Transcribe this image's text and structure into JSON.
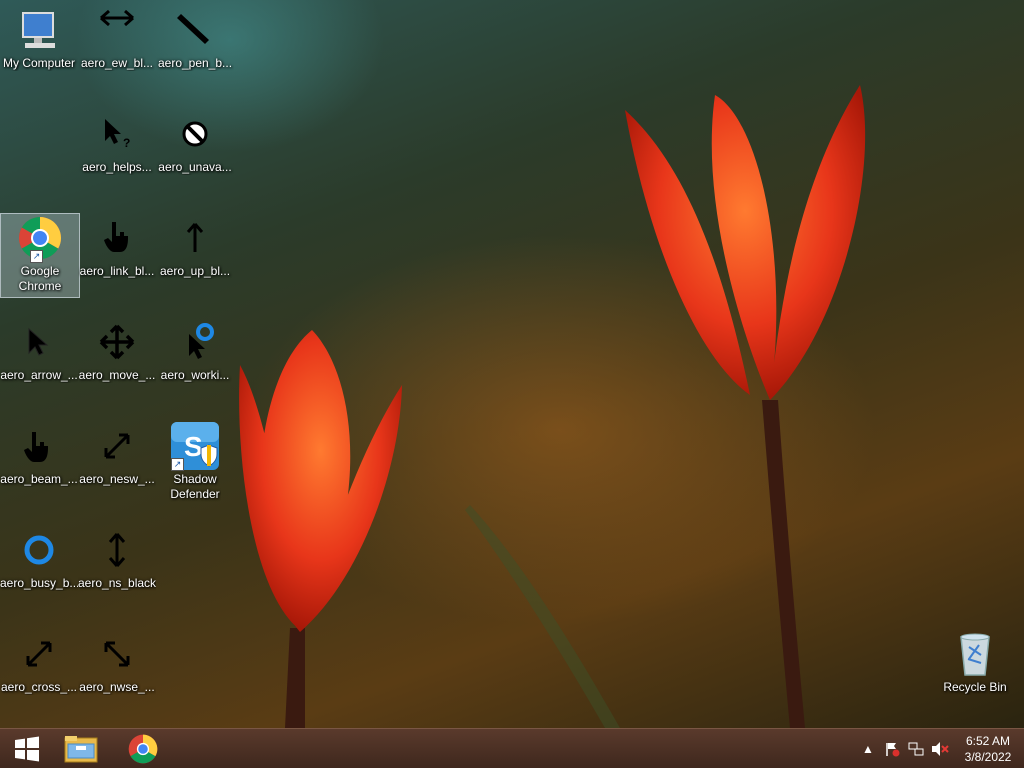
{
  "desktop": {
    "icons": [
      {
        "label": "My Computer",
        "icon": "computer-icon"
      },
      {
        "label": "aero_ew_bl...",
        "icon": "resize-ew-icon"
      },
      {
        "label": "aero_pen_b...",
        "icon": "pen-icon"
      },
      {
        "label": "aero_helps...",
        "icon": "help-select-icon"
      },
      {
        "label": "aero_unava...",
        "icon": "unavailable-icon"
      },
      {
        "label": "Google Chrome",
        "icon": "chrome-icon"
      },
      {
        "label": "aero_link_bl...",
        "icon": "hand-link-icon"
      },
      {
        "label": "aero_up_bl...",
        "icon": "up-arrow-icon"
      },
      {
        "label": "aero_arrow_...",
        "icon": "arrow-cursor-icon"
      },
      {
        "label": "aero_move_...",
        "icon": "move-icon"
      },
      {
        "label": "aero_worki...",
        "icon": "working-icon"
      },
      {
        "label": "aero_beam_...",
        "icon": "hand-beam-icon"
      },
      {
        "label": "aero_nesw_...",
        "icon": "resize-nesw-icon"
      },
      {
        "label": "Shadow Defender",
        "icon": "shadow-defender-icon"
      },
      {
        "label": "aero_busy_b...",
        "icon": "busy-icon"
      },
      {
        "label": "aero_ns_black",
        "icon": "resize-ns-icon"
      },
      {
        "label": "aero_cross_...",
        "icon": "resize-cross-icon"
      },
      {
        "label": "aero_nwse_...",
        "icon": "resize-nwse-icon"
      },
      {
        "label": "Recycle Bin",
        "icon": "recycle-bin-icon"
      }
    ]
  },
  "taskbar": {
    "start": "windows-start-icon",
    "pinned": [
      "file-explorer-icon",
      "chrome-icon"
    ],
    "tray": {
      "icons": [
        "show-hidden-icons-icon",
        "action-center-flag-icon",
        "network-icon",
        "volume-muted-icon"
      ],
      "time": "6:52 AM",
      "date": "3/8/2022"
    }
  },
  "colors": {
    "accent": "#1e88e5",
    "taskbar": "#4a3024",
    "tulip": "#e8361a"
  }
}
